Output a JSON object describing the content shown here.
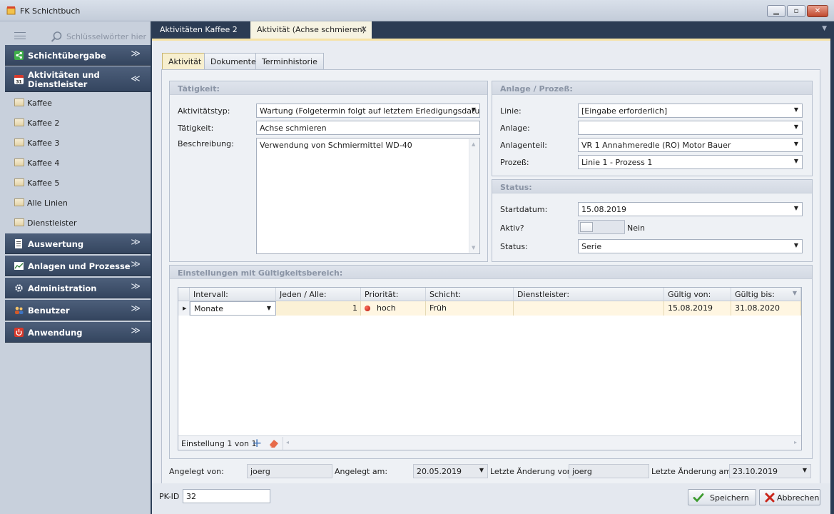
{
  "window": {
    "title": "FK Schichtbuch"
  },
  "sidebar": {
    "search_placeholder": "Schlüsselwörter hier e",
    "groups": [
      {
        "label": "Schichtübergabe",
        "expanded": false
      },
      {
        "label": "Aktivitäten und Dienstleister",
        "expanded": true,
        "items": [
          "Kaffee",
          "Kaffee 2",
          "Kaffee 3",
          "Kaffee 4",
          "Kaffee 5",
          "Alle Linien",
          "Dienstleister"
        ]
      },
      {
        "label": "Auswertung",
        "expanded": false
      },
      {
        "label": "Anlagen und Prozesse",
        "expanded": false
      },
      {
        "label": "Administration",
        "expanded": false
      },
      {
        "label": "Benutzer",
        "expanded": false
      },
      {
        "label": "Anwendung",
        "expanded": false
      }
    ]
  },
  "doc_tabs": [
    {
      "label": "Aktivitäten Kaffee 2",
      "active": false
    },
    {
      "label": "Aktivität (Achse schmieren)",
      "active": true
    }
  ],
  "inner_tabs": [
    {
      "label": "Aktivität",
      "active": true
    },
    {
      "label": "Dokumente",
      "active": false
    },
    {
      "label": "Terminhistorie",
      "active": false
    }
  ],
  "taetigkeit": {
    "title": "Tätigkeit:",
    "typ_label": "Aktivitätstyp:",
    "typ_value": "Wartung (Folgetermin folgt auf letztem Erledigungsdatum)",
    "taetigkeit_label": "Tätigkeit:",
    "taetigkeit_value": "Achse schmieren",
    "beschreibung_label": "Beschreibung:",
    "beschreibung_value": "Verwendung von Schmiermittel WD-40"
  },
  "anlage": {
    "title": "Anlage / Prozeß:",
    "linie_label": "Linie:",
    "linie_value": "[Eingabe erforderlich]",
    "anlage_label": "Anlage:",
    "anlage_value": "",
    "anlagenteil_label": "Anlagenteil:",
    "anlagenteil_value": "VR 1 Annahmeredle (RO) Motor Bauer",
    "prozess_label": "Prozeß:",
    "prozess_value": "Linie 1 - Prozess 1"
  },
  "status": {
    "title": "Status:",
    "startdatum_label": "Startdatum:",
    "startdatum_value": "15.08.2019",
    "aktiv_label": "Aktiv?",
    "aktiv_state": "Nein",
    "status_label": "Status:",
    "status_value": "Serie"
  },
  "einstellungen": {
    "title": "Einstellungen mit Gültigkeitsbereich:",
    "columns": [
      "Intervall:",
      "Jeden / Alle:",
      "Priorität:",
      "Schicht:",
      "Dienstleister:",
      "Gültig von:",
      "Gültig bis:"
    ],
    "rows": [
      {
        "intervall": "Monate",
        "jeden": "1",
        "prioritaet": "hoch",
        "schicht": "Früh",
        "dienstleister": "",
        "gueltig_von": "15.08.2019",
        "gueltig_bis": "31.08.2020"
      }
    ],
    "navigator": "Einstellung 1 von 1"
  },
  "footer_meta": {
    "angelegt_von_label": "Angelegt von:",
    "angelegt_von_value": "joerg",
    "angelegt_am_label": "Angelegt am:",
    "angelegt_am_value": "20.05.2019",
    "geaendert_von_label": "Letzte Änderung von:",
    "geaendert_von_value": "joerg",
    "geaendert_am_label": "Letzte Änderung am:",
    "geaendert_am_value": "23.10.2019"
  },
  "bottom": {
    "pkid_label": "PK-ID",
    "pkid_value": "32",
    "save_label": "Speichern",
    "cancel_label": "Abbrechen"
  }
}
